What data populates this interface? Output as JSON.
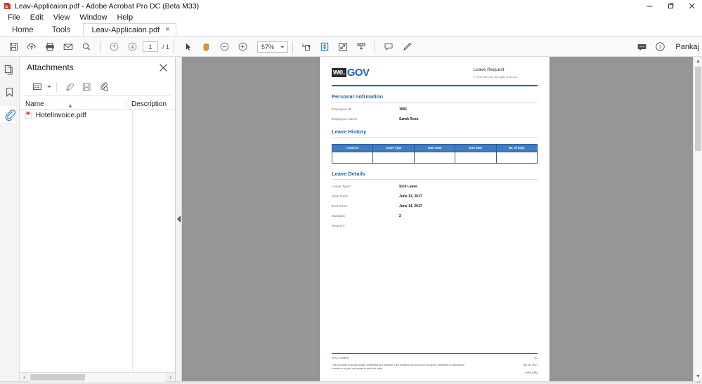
{
  "window": {
    "title": "Leav-Applicaion.pdf - Adobe Acrobat Pro DC (Beta M33)",
    "minimize": "minimize-icon",
    "restore": "restore-icon",
    "close": "close-icon"
  },
  "menubar": {
    "items": [
      {
        "label": "File"
      },
      {
        "label": "Edit"
      },
      {
        "label": "View"
      },
      {
        "label": "Window"
      },
      {
        "label": "Help"
      }
    ]
  },
  "tabs": {
    "home": "Home",
    "tools": "Tools",
    "document": "Leav-Applicaion.pdf",
    "close": "×"
  },
  "toolbar": {
    "buttons": [
      {
        "name": "save-file-icon"
      },
      {
        "name": "upload-cloud-icon"
      },
      {
        "name": "print-icon"
      },
      {
        "name": "email-icon"
      },
      {
        "name": "search-icon"
      }
    ],
    "page_nav": {
      "prev": "previous-page-icon",
      "next": "next-page-icon",
      "current_page": "1",
      "total_pages": "/ 1"
    },
    "tools": [
      {
        "name": "select-cursor-icon"
      },
      {
        "name": "hand-tool-icon"
      },
      {
        "name": "zoom-out-icon"
      },
      {
        "name": "zoom-in-icon"
      }
    ],
    "zoom_level": "57%",
    "view_buttons": [
      {
        "name": "fit-page-icon"
      },
      {
        "name": "page-fit-blue-icon"
      },
      {
        "name": "fullscreen-icon"
      },
      {
        "name": "scroll-down-icon"
      }
    ],
    "annotate_buttons": [
      {
        "name": "comment-icon"
      },
      {
        "name": "highlight-pen-icon"
      }
    ],
    "right": {
      "comment_icon": "comment-balloon-icon",
      "help_icon": "help-question-icon",
      "user": "Pankaj"
    }
  },
  "rail": {
    "items": [
      {
        "name": "page-thumbnails-icon",
        "active": false
      },
      {
        "name": "bookmarks-icon",
        "active": false
      },
      {
        "name": "attachments-icon",
        "active": true
      }
    ]
  },
  "panel": {
    "title": "Attachments",
    "close_icon": "close-icon",
    "toolbar": [
      {
        "name": "options-list-icon"
      },
      {
        "name": "open-attachment-icon"
      },
      {
        "name": "save-attachment-icon"
      },
      {
        "name": "search-attachment-icon"
      }
    ],
    "columns": {
      "name": "Name",
      "description": "Description"
    },
    "sort_indicator": "▲",
    "rows": [
      {
        "icon": "pdf-file-icon",
        "name": "HotelInvoice.pdf",
        "description": ""
      }
    ],
    "hscroll": {
      "left": "‹",
      "right": "›"
    }
  },
  "collapse_handle": {
    "name": "collapse-panel-arrow"
  },
  "document": {
    "logo": {
      "we": "we.",
      "gov": "GOV"
    },
    "header": {
      "title": "Leave Request",
      "copyright": "© 2017 We.Gov. All rights reserved."
    },
    "sections": {
      "personal": {
        "title": "Personal nofrmation",
        "fields": [
          {
            "label": "Employee  ID",
            "value": "1001"
          },
          {
            "label": "Employee  Name",
            "value": "Sarah  Rose"
          }
        ]
      },
      "history": {
        "title": "Leave History",
        "columns": [
          "Leave ID",
          "Leave Type",
          "Start Date",
          "End Date",
          "No. of Days"
        ],
        "rows": [
          [
            "",
            "",
            "",
            "",
            ""
          ]
        ]
      },
      "details": {
        "title": "Leave Details",
        "fields": [
          {
            "label": "Leave Type*",
            "value": "Sick Leave"
          },
          {
            "label": "Start Date*",
            "value": "June 13, 2017"
          },
          {
            "label": "End Date*",
            "value": "June 14, 2017"
          },
          {
            "label": "Duration",
            "value": "2"
          },
          {
            "label": "Reason*",
            "value": ""
          }
        ]
      }
    },
    "footer": {
      "disclaimer_title": "DISCLAIMER",
      "page_number": "1/1",
      "disclaimer_body": "This document is strictly private, confidential and personal to the recipient and should not be copied, distributed or reproduced in whole or in part, nor passed to any third party.",
      "date": "Jun 16, 2017",
      "time": "4:09:16 AM"
    }
  },
  "viewport_scroll": {
    "up": "▲",
    "down": "▼"
  },
  "colors": {
    "brand_blue": "#1b63b5",
    "table_header": "#3f7cc1",
    "page_bg": "#969696",
    "accent_icon": "#2d7fc1"
  }
}
